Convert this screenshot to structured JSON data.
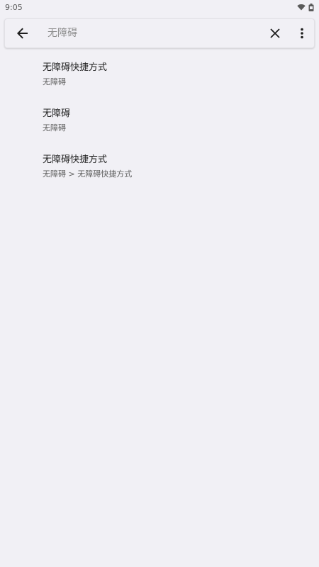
{
  "status_bar": {
    "time": "9:05",
    "wifi_icon": "wifi-icon",
    "battery_icon": "battery-icon"
  },
  "search": {
    "value": "",
    "placeholder": "无障碍",
    "back_icon": "arrow-back-icon",
    "clear_icon": "close-icon",
    "more_icon": "more-vert-icon"
  },
  "results": [
    {
      "title": "无障碍快捷方式",
      "summary": "无障碍"
    },
    {
      "title": "无障碍",
      "summary": "无障碍"
    },
    {
      "title": "无障碍快捷方式",
      "summary": "无障碍 > 无障碍快捷方式"
    }
  ],
  "colors": {
    "background": "#f1f0f5",
    "text_primary": "#1f1f1f",
    "text_secondary": "#5f5f5f"
  }
}
